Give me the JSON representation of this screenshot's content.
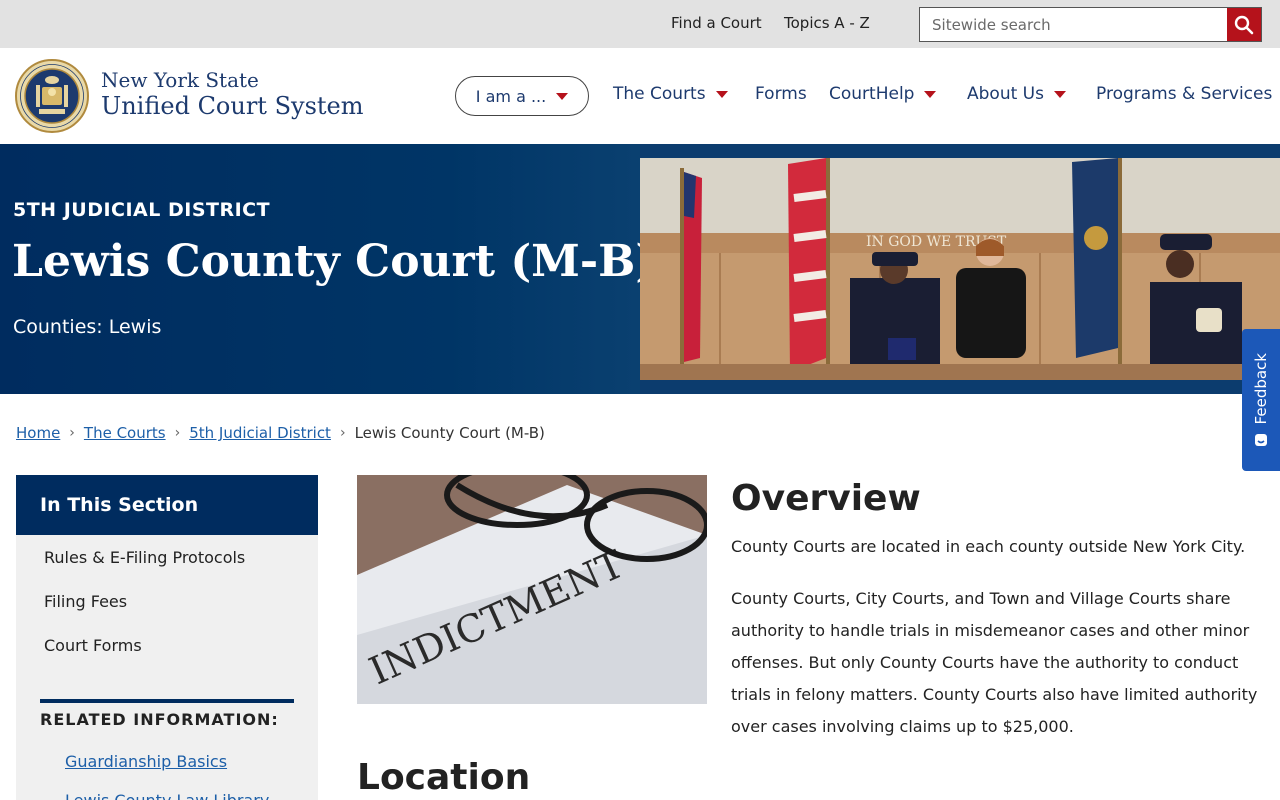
{
  "utility": {
    "find_court": "Find a Court",
    "topics": "Topics A - Z",
    "search_placeholder": "Sitewide search"
  },
  "brand": {
    "line1": "New York State",
    "line2": "Unified Court System"
  },
  "nav": {
    "iam": "I am a ...",
    "items": [
      {
        "label": "The Courts",
        "dropdown": true
      },
      {
        "label": "Forms",
        "dropdown": false
      },
      {
        "label": "CourtHelp",
        "dropdown": true
      },
      {
        "label": "About Us",
        "dropdown": true
      },
      {
        "label": "Programs & Services",
        "dropdown": false
      }
    ]
  },
  "hero": {
    "eyebrow": "5TH JUDICIAL DISTRICT",
    "title": "Lewis County Court (M-B)",
    "subtitle": "Counties: Lewis",
    "photo_sign": "IN GOD WE TRUST"
  },
  "feedback": {
    "label": "Feedback"
  },
  "breadcrumb": {
    "items": [
      "Home",
      "The Courts",
      "5th Judicial District"
    ],
    "current": "Lewis County Court (M-B)"
  },
  "sidebar": {
    "title": "In This Section",
    "links": [
      "Rules & E-Filing Protocols",
      "Filing Fees",
      "Court Forms"
    ],
    "related_title": "RELATED INFORMATION:",
    "related_links": [
      "Guardianship Basics",
      "Lewis County Law Library"
    ]
  },
  "main": {
    "image_text": "INDICTMENT",
    "overview_title": "Overview",
    "overview_p1": "County Courts are located in each county outside New York City.",
    "overview_p2": "County Courts, City Courts, and Town and Village Courts share authority to handle trials in misdemeanor cases and other minor offenses. But only County Courts have the authority to conduct trials in felony matters. County Courts also have limited authority over cases involving claims up to $25,000.",
    "location_title": "Location"
  },
  "colors": {
    "navy": "#002c5f",
    "nav_text": "#1d3a6e",
    "accent_red": "#b5121b",
    "link_blue": "#1d5fa8",
    "feedback_blue": "#1c58b8"
  }
}
